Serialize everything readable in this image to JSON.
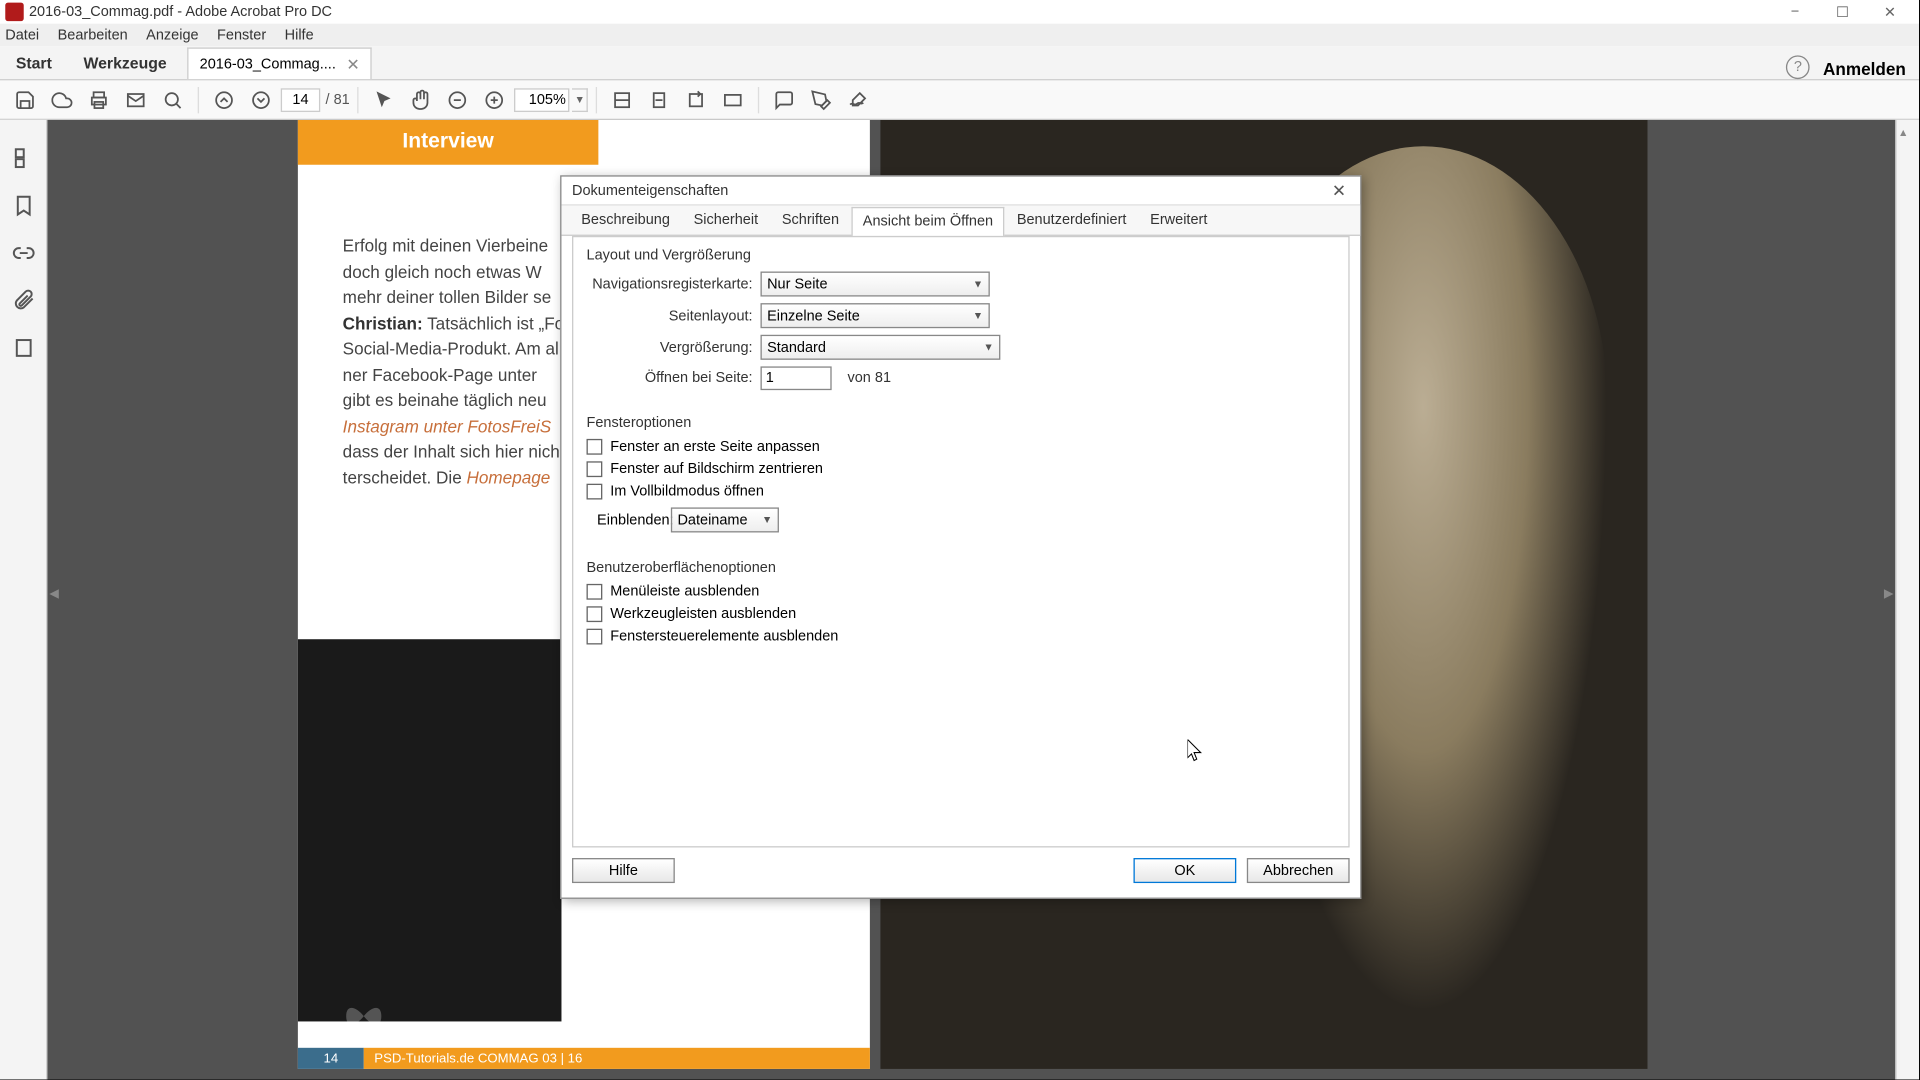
{
  "titlebar": {
    "text": "2016-03_Commag.pdf - Adobe Acrobat Pro DC"
  },
  "menubar": {
    "items": [
      "Datei",
      "Bearbeiten",
      "Anzeige",
      "Fenster",
      "Hilfe"
    ]
  },
  "tabbar": {
    "start": "Start",
    "tools": "Werkzeuge",
    "doc_tab": "2016-03_Commag....",
    "signin": "Anmelden"
  },
  "toolbar": {
    "page_current": "14",
    "page_total": "/ 81",
    "zoom": "105%"
  },
  "page": {
    "header": "Interview",
    "line1": "Erfolg mit deinen Vierbeine",
    "line2": "doch gleich noch etwas W",
    "line3": "mehr deiner tollen Bilder se",
    "bold4": "Christian:",
    "line4": " Tatsächlich ist „Fo",
    "line5": "Social-Media-Produkt. Am al",
    "line6": "ner Facebook-Page unter",
    "line7": "gibt es beinahe täglich neu",
    "link8a": "Instagram unter FotosFreiS",
    "line9": "dass der Inhalt sich hier nich",
    "line10a": "terscheidet. Die ",
    "link10b": "Homepage",
    "footer_num": "14",
    "footer_text": "PSD-Tutorials.de  COMMAG 03 | 16"
  },
  "dialog": {
    "title": "Dokumenteigenschaften",
    "tabs": [
      "Beschreibung",
      "Sicherheit",
      "Schriften",
      "Ansicht beim Öffnen",
      "Benutzerdefiniert",
      "Erweitert"
    ],
    "active_tab": 3,
    "group1": "Layout und Vergrößerung",
    "nav_label": "Navigationsregisterkarte:",
    "nav_value": "Nur Seite",
    "layout_label": "Seitenlayout:",
    "layout_value": "Einzelne Seite",
    "mag_label": "Vergrößerung:",
    "mag_value": "Standard",
    "open_label": "Öffnen bei Seite:",
    "open_value": "1",
    "open_of": "von 81",
    "group2": "Fensteroptionen",
    "c1": "Fenster an erste Seite anpassen",
    "c2": "Fenster auf Bildschirm zentrieren",
    "c3": "Im Vollbildmodus öffnen",
    "show_label": "Einblenden:",
    "show_value": "Dateiname",
    "group3": "Benutzeroberflächenoptionen",
    "c4": "Menüleiste ausblenden",
    "c5": "Werkzeugleisten ausblenden",
    "c6": "Fenstersteuerelemente ausblenden",
    "help": "Hilfe",
    "ok": "OK",
    "cancel": "Abbrechen"
  }
}
